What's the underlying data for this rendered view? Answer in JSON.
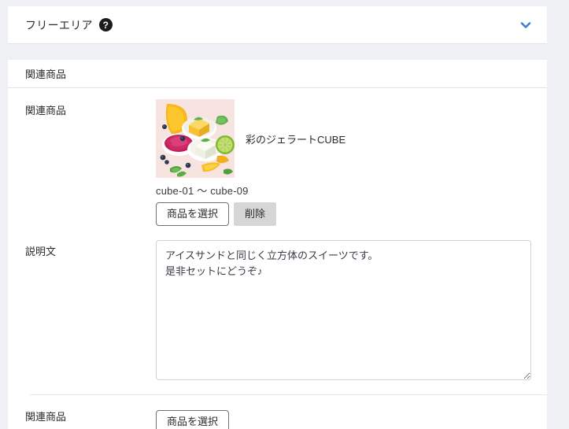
{
  "freearea": {
    "title": "フリーエリア",
    "help_icon": "question-mark-circle-icon",
    "toggle_icon": "chevron-down-icon",
    "toggle_color": "#3f7fd0"
  },
  "card": {
    "header": "関連商品",
    "rows": [
      {
        "label": "関連商品",
        "product": {
          "thumbnail_alt": "gelato-cube-assortment-photo",
          "name": "彩のジェラートCUBE",
          "code_range": "cube-01 〜 cube-09",
          "buttons": [
            {
              "label": "商品を選択",
              "style": "outline"
            },
            {
              "label": "削除",
              "style": "grey"
            }
          ]
        }
      },
      {
        "label": "説明文",
        "textarea": {
          "value": "アイスサンドと同じく立方体のスイーツです。\n是非セットにどうぞ♪",
          "placeholder": ""
        }
      },
      {
        "label": "関連商品",
        "buttons": [
          {
            "label": "商品を選択",
            "style": "outline"
          }
        ]
      }
    ]
  },
  "colors": {
    "page_background": "#eef0f3",
    "panel_background": "#ffffff",
    "border": "#e2e4e8",
    "accent": "#3f7fd0",
    "text": "#2b2b2b",
    "grey_button": "#d6d6d6"
  }
}
